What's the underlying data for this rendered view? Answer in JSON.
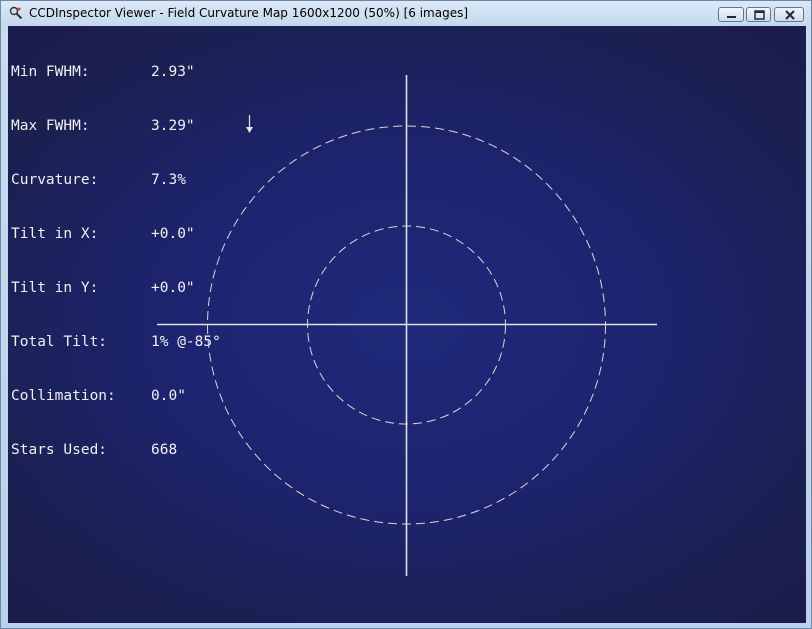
{
  "window": {
    "title": "CCDInspector Viewer - Field Curvature Map 1600x1200 (50%)  [6 images]"
  },
  "stats": [
    {
      "label": "Min FWHM:",
      "value": "2.93\""
    },
    {
      "label": "Max FWHM:",
      "value": "3.29\""
    },
    {
      "label": "Curvature:",
      "value": "7.3%"
    },
    {
      "label": "Tilt in X:",
      "value": "+0.0\""
    },
    {
      "label": "Tilt in Y:",
      "value": "+0.0\""
    },
    {
      "label": "Total Tilt:",
      "value": "1% @-85°"
    },
    {
      "label": "Collimation:",
      "value": "0.0\""
    },
    {
      "label": "Stars Used:",
      "value": "668"
    }
  ],
  "colors": {
    "background_center": "#1f2a7a",
    "background_edge": "#2a2ca0",
    "overlay": "#d8d8d8"
  },
  "icons": {
    "app": "ccdinspector-app-icon",
    "tilt_direction": "arrow-down-icon",
    "minimize": "minimize-icon",
    "maximize": "maximize-icon",
    "close": "close-icon"
  }
}
